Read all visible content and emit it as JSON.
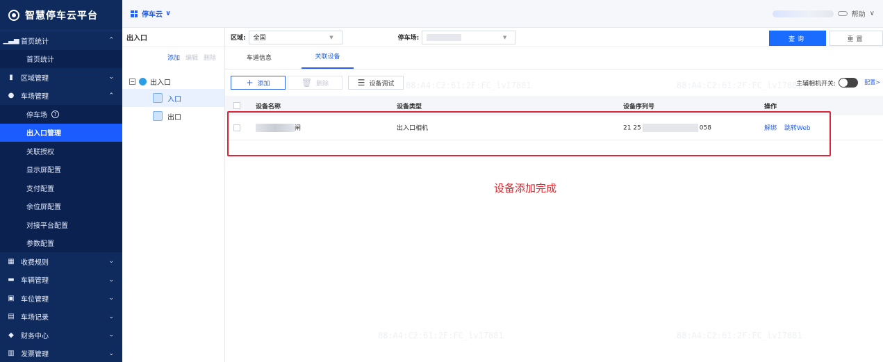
{
  "brand": {
    "title": "智慧停车云平台"
  },
  "topbar": {
    "app": "停车云",
    "help": "帮助"
  },
  "sidebar": {
    "groups": [
      {
        "label": "首页统计",
        "arrow": "^",
        "children": [
          "首页统计"
        ]
      },
      {
        "label": "区域管理",
        "arrow": "v"
      },
      {
        "label": "车场管理",
        "arrow": "^",
        "children": [
          "停车场",
          "出入口管理",
          "关联授权",
          "显示屏配置",
          "支付配置",
          "余位屏配置",
          "对接平台配置",
          "参数配置"
        ]
      },
      {
        "label": "收费规则",
        "arrow": "v"
      },
      {
        "label": "车辆管理",
        "arrow": "v"
      },
      {
        "label": "车位管理",
        "arrow": "v"
      },
      {
        "label": "车场记录",
        "arrow": "v"
      },
      {
        "label": "财务中心",
        "arrow": "v"
      },
      {
        "label": "发票管理",
        "arrow": "v"
      }
    ],
    "active_child": "出入口管理"
  },
  "tree": {
    "title": "出入口",
    "actions": {
      "add": "添加",
      "edit": "编辑",
      "delete": "删除"
    },
    "root": "出入口",
    "nodes": [
      "入口",
      "出口"
    ]
  },
  "filter": {
    "area_label": "区域:",
    "area_value": "全国",
    "lot_label": "停车场:",
    "query": "查询",
    "reset": "重置"
  },
  "tabs": [
    "车道信息",
    "关联设备"
  ],
  "toolbar": {
    "add": "添加",
    "delete": "删除",
    "debug": "设备调试",
    "main_switch": "主辅相机开关:",
    "config": "配置>"
  },
  "table": {
    "headers": [
      "设备名称",
      "设备类型",
      "设备序列号",
      "操作"
    ],
    "rows": [
      {
        "name_suffix": "闸",
        "type": "出入口相机",
        "sn_prefix": "21",
        "sn_mid": "25",
        "sn_suffix": "058",
        "actions": [
          "解绑",
          "跳转Web"
        ]
      }
    ]
  },
  "annotation": "设备添加完成",
  "watermark": "88:A4:C2:61:2F:FC_lv17881"
}
